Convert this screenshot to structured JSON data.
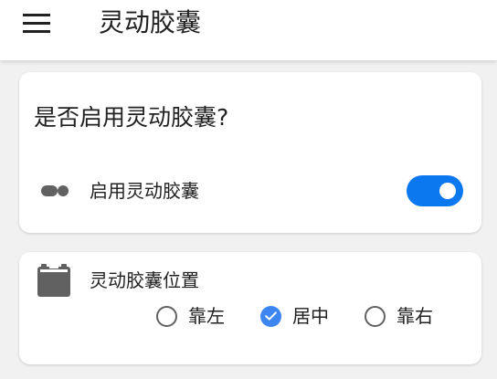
{
  "appbar": {
    "title": "灵动胶囊",
    "menu_icon": "hamburger-menu-icon"
  },
  "enable_card": {
    "heading": "是否启用灵动胶囊?",
    "row_icon": "capsule-icon",
    "row_label": "启用灵动胶囊",
    "toggle_on": true
  },
  "position_card": {
    "icon": "calendar-icon",
    "label": "灵动胶囊位置",
    "options": [
      {
        "label": "靠左",
        "selected": false
      },
      {
        "label": "居中",
        "selected": true
      },
      {
        "label": "靠右",
        "selected": false
      }
    ]
  },
  "colors": {
    "accent": "#0b78f0",
    "radio_checked": "#3d86f2",
    "background": "#f1f1f1",
    "card": "#ffffff",
    "icon_gray": "#616161"
  }
}
